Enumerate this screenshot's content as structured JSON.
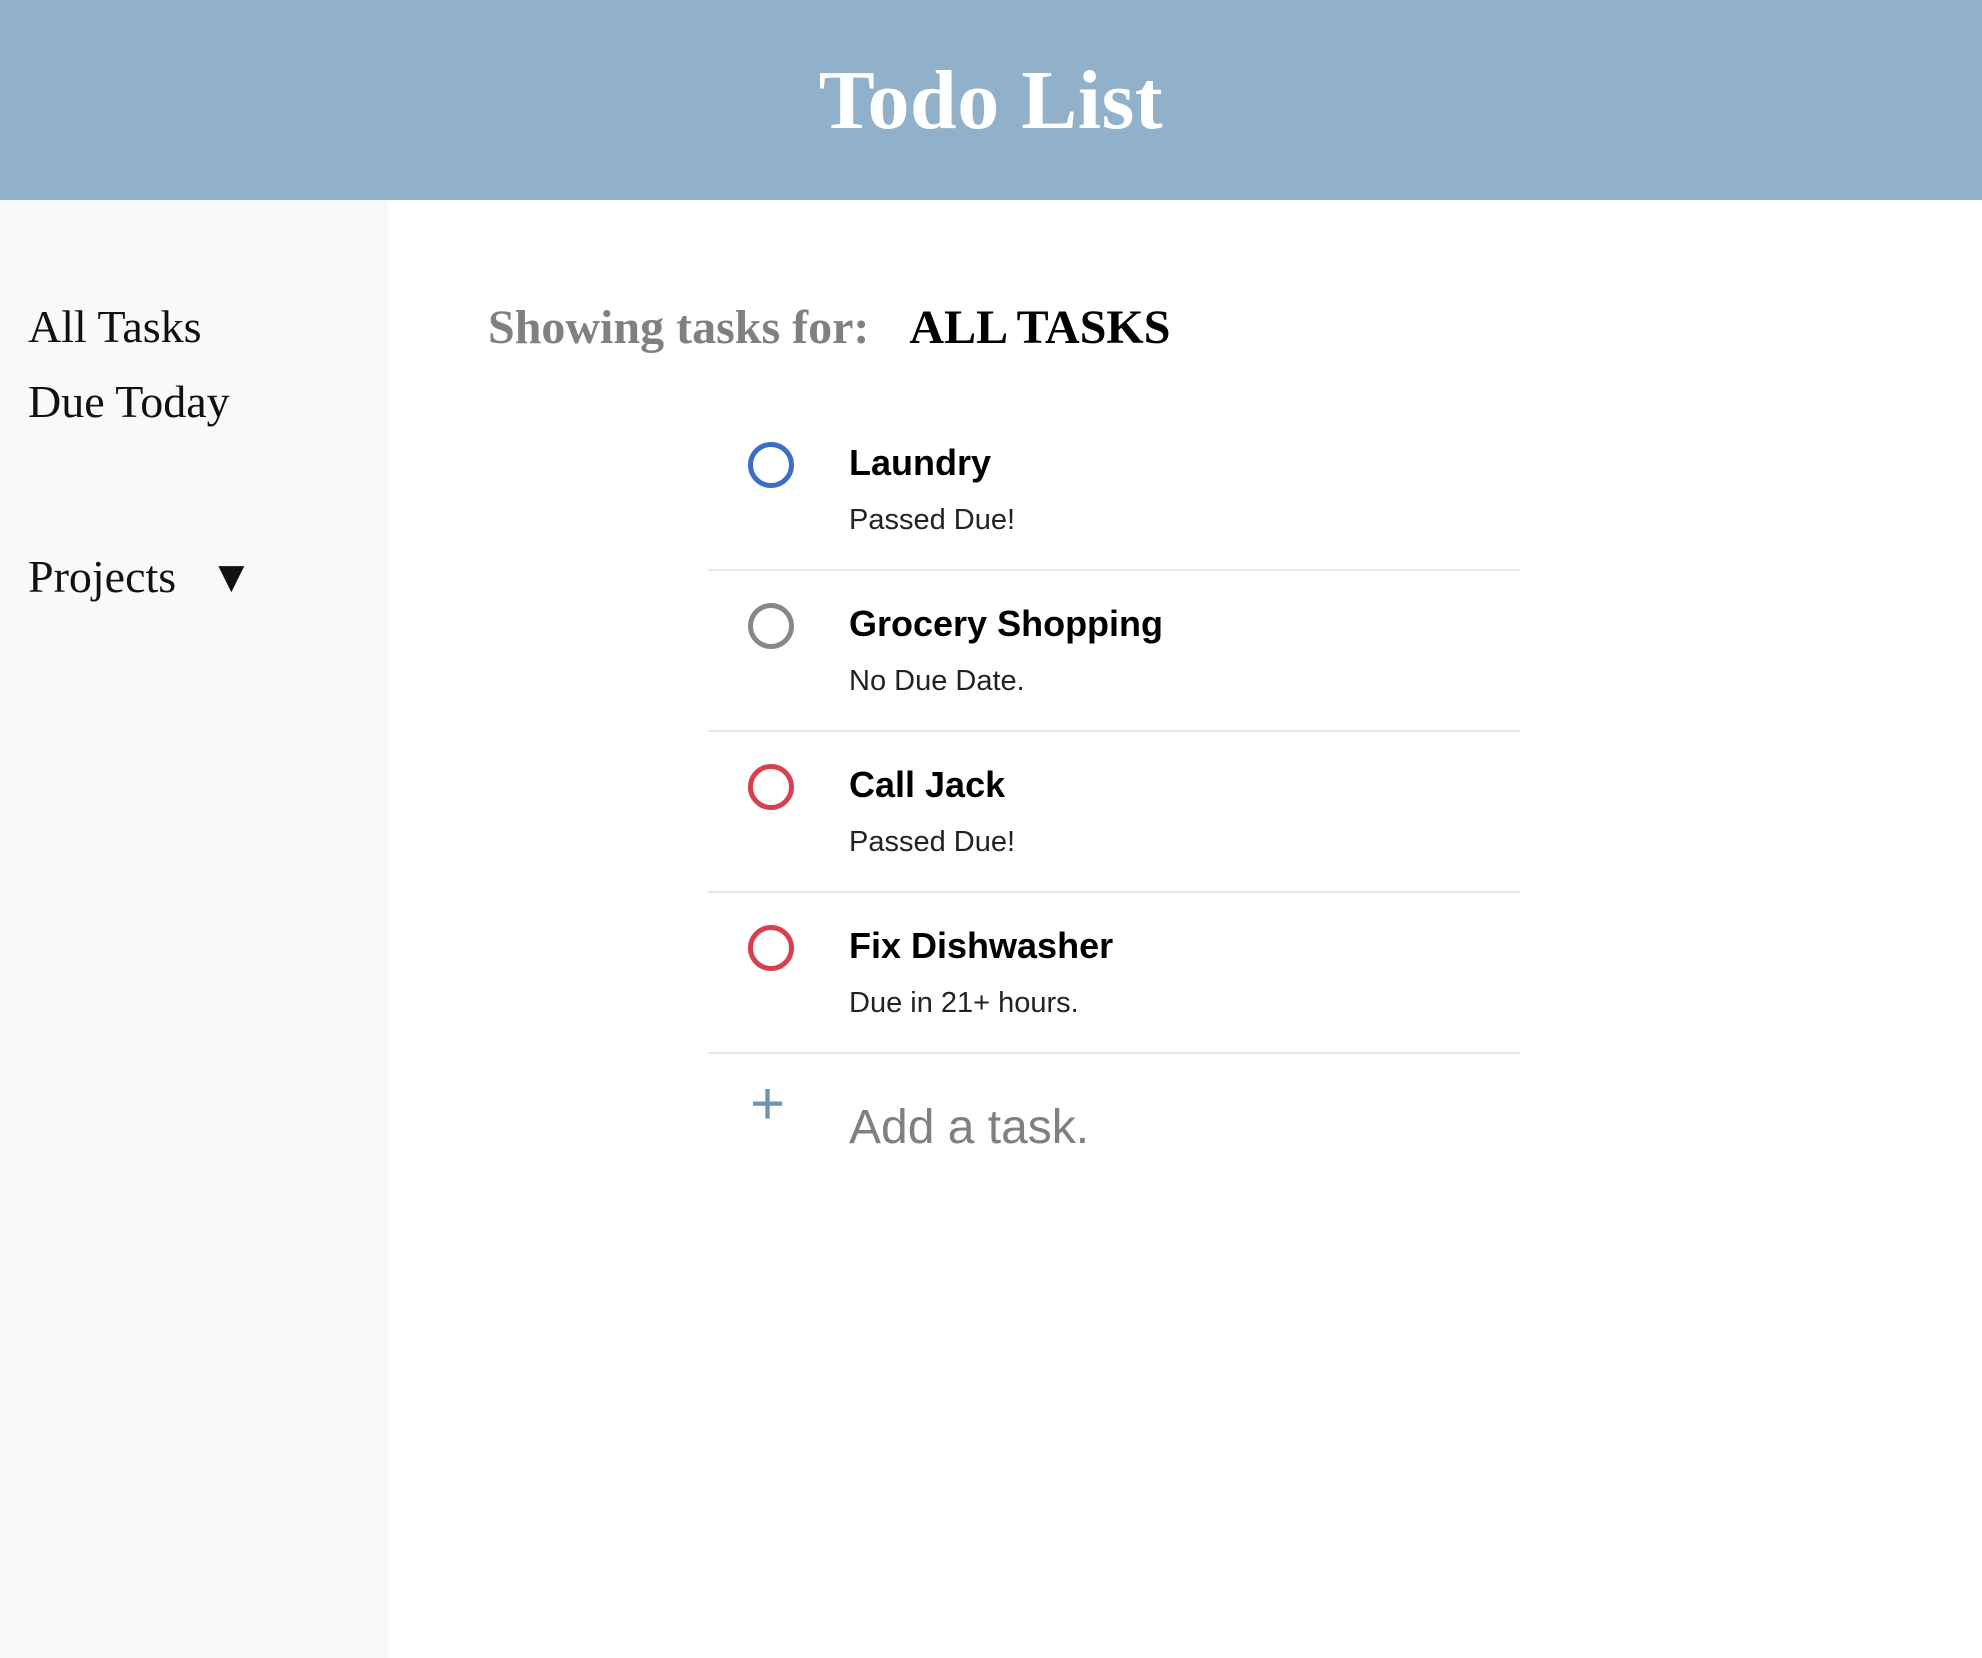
{
  "header": {
    "title": "Todo List",
    "background": "#91b1ca"
  },
  "sidebar": {
    "items": [
      {
        "label": "All Tasks"
      },
      {
        "label": "Due Today"
      }
    ],
    "projects": {
      "label": "Projects",
      "caret": "▼"
    }
  },
  "main": {
    "heading_label": "Showing tasks for:",
    "heading_value": "ALL TASKS",
    "tasks": [
      {
        "name": "Laundry",
        "due": "Passed Due!",
        "check_color": "#3a6fc4"
      },
      {
        "name": "Grocery Shopping",
        "due": "No Due Date.",
        "check_color": "#888888"
      },
      {
        "name": "Call Jack",
        "due": "Passed Due!",
        "check_color": "#d9404f"
      },
      {
        "name": "Fix Dishwasher",
        "due": "Due in 21+ hours.",
        "check_color": "#d9404f"
      }
    ],
    "add_task": {
      "icon": "+",
      "placeholder": "Add a task.",
      "value": ""
    }
  }
}
